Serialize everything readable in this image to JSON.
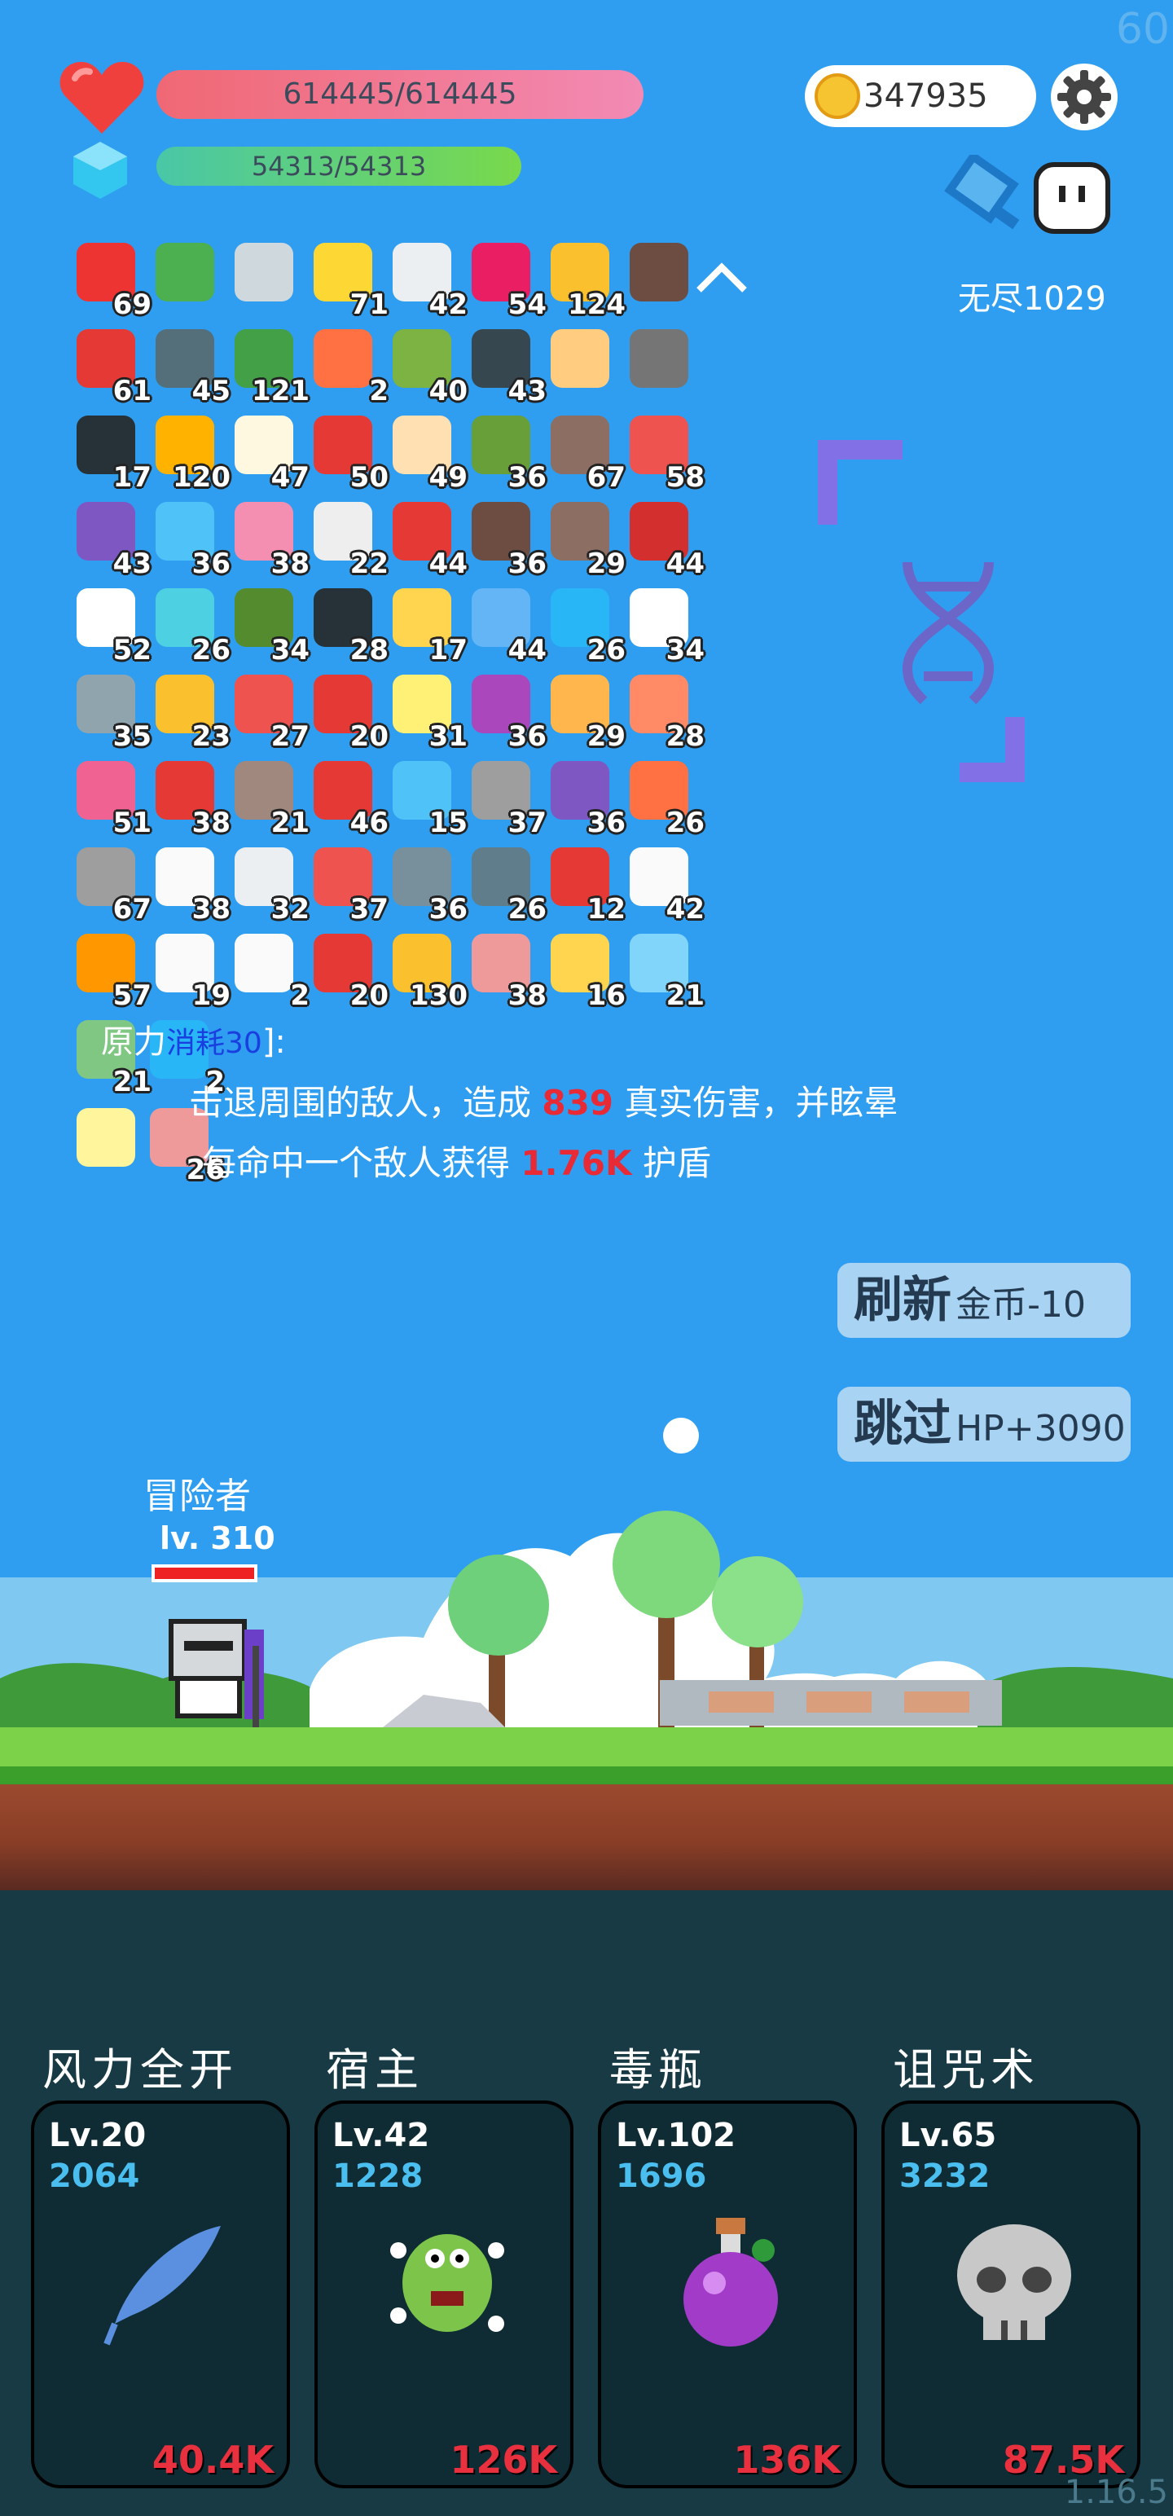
{
  "fps": "60",
  "version": "1.16.5",
  "player": {
    "hp": "614445/614445",
    "mp": "54313/54313"
  },
  "gold": "347935",
  "mode": "无尽1029",
  "items": [
    {
      "n": "sock",
      "c": "69",
      "col": "#e33"
    },
    {
      "n": "book",
      "c": "",
      "col": "#4caf50"
    },
    {
      "n": "sword",
      "c": "",
      "col": "#cfd8dc"
    },
    {
      "n": "star-card",
      "c": "71",
      "col": "#fdd835"
    },
    {
      "n": "letter",
      "c": "42",
      "col": "#eceff1"
    },
    {
      "n": "jam",
      "c": "54",
      "col": "#e91e63"
    },
    {
      "n": "crown",
      "c": "124",
      "col": "#fbc02d"
    },
    {
      "n": "mortar",
      "c": "",
      "col": "#6d4c41"
    },
    {
      "n": "apple",
      "c": "61",
      "col": "#e53935"
    },
    {
      "n": "shield",
      "c": "45",
      "col": "#546e7a"
    },
    {
      "n": "money-heart",
      "c": "121",
      "col": "#43a047"
    },
    {
      "n": "torch",
      "c": "2",
      "col": "#ff7043"
    },
    {
      "n": "cactus",
      "c": "40",
      "col": "#7cb342"
    },
    {
      "n": "bat",
      "c": "43",
      "col": "#37474f"
    },
    {
      "n": "scroll",
      "c": "",
      "col": "#ffcc80"
    },
    {
      "n": "helmet",
      "c": "",
      "col": "#757575"
    },
    {
      "n": "cauldron",
      "c": "17",
      "col": "#263238"
    },
    {
      "n": "bug",
      "c": "120",
      "col": "#ffb300"
    },
    {
      "n": "egg",
      "c": "47",
      "col": "#fff8e1"
    },
    {
      "n": "strawberry",
      "c": "50",
      "col": "#e53935"
    },
    {
      "n": "glove",
      "c": "49",
      "col": "#ffe0b2"
    },
    {
      "n": "turtle",
      "c": "36",
      "col": "#689f38"
    },
    {
      "n": "round-shield",
      "c": "67",
      "col": "#8d6e63"
    },
    {
      "n": "watermelon",
      "c": "58",
      "col": "#ef5350"
    },
    {
      "n": "purple-shield",
      "c": "43",
      "col": "#7e57c2"
    },
    {
      "n": "blue-gem",
      "c": "36",
      "col": "#4fc3f7"
    },
    {
      "n": "ice-cream",
      "c": "38",
      "col": "#f48fb1"
    },
    {
      "n": "bulb",
      "c": "22",
      "col": "#eeeeee"
    },
    {
      "n": "mushroom",
      "c": "44",
      "col": "#e53935"
    },
    {
      "n": "coconut",
      "c": "36",
      "col": "#6d4c41"
    },
    {
      "n": "door",
      "c": "29",
      "col": "#8d6e63"
    },
    {
      "n": "red-shield",
      "c": "44",
      "col": "#d32f2f"
    },
    {
      "n": "flower",
      "c": "52",
      "col": "#ffffff"
    },
    {
      "n": "potion",
      "c": "26",
      "col": "#4dd0e1"
    },
    {
      "n": "grenade",
      "c": "34",
      "col": "#558b2f"
    },
    {
      "n": "hook",
      "c": "28",
      "col": "#263238"
    },
    {
      "n": "magic-wand",
      "c": "17",
      "col": "#ffd54f"
    },
    {
      "n": "pill",
      "c": "44",
      "col": "#64b5f6"
    },
    {
      "n": "chat",
      "c": "26",
      "col": "#29b6f6"
    },
    {
      "n": "ghost",
      "c": "34",
      "col": "#ffffff"
    },
    {
      "n": "disc",
      "c": "35",
      "col": "#90a4ae"
    },
    {
      "n": "sunflower",
      "c": "23",
      "col": "#fbc02d"
    },
    {
      "n": "capsule",
      "c": "27",
      "col": "#ef5350"
    },
    {
      "n": "flask",
      "c": "20",
      "col": "#e53935"
    },
    {
      "n": "note",
      "c": "31",
      "col": "#fff176"
    },
    {
      "n": "crystal-ball",
      "c": "36",
      "col": "#ab47bc"
    },
    {
      "n": "paper-scroll",
      "c": "29",
      "col": "#ffb74d"
    },
    {
      "n": "cake",
      "c": "28",
      "col": "#ff8a65"
    },
    {
      "n": "perfume",
      "c": "51",
      "col": "#f06292"
    },
    {
      "n": "gift",
      "c": "38",
      "col": "#e53935"
    },
    {
      "n": "bow",
      "c": "21",
      "col": "#a1887f"
    },
    {
      "n": "heart",
      "c": "46",
      "col": "#e53935"
    },
    {
      "n": "target",
      "c": "15",
      "col": "#4fc3f7"
    },
    {
      "n": "spike-ball",
      "c": "37",
      "col": "#9e9e9e"
    },
    {
      "n": "box",
      "c": "36",
      "col": "#7e57c2"
    },
    {
      "n": "meteor",
      "c": "26",
      "col": "#ff7043"
    },
    {
      "n": "knife",
      "c": "67",
      "col": "#9e9e9e"
    },
    {
      "n": "cloud",
      "c": "38",
      "col": "#fafafa"
    },
    {
      "n": "clipboard",
      "c": "32",
      "col": "#eceff1"
    },
    {
      "n": "thermometer",
      "c": "37",
      "col": "#ef5350"
    },
    {
      "n": "axe",
      "c": "36",
      "col": "#78909c"
    },
    {
      "n": "compass",
      "c": "26",
      "col": "#607d8b"
    },
    {
      "n": "hearts",
      "c": "12",
      "col": "#e53935"
    },
    {
      "n": "cards",
      "c": "42",
      "col": "#fafafa"
    },
    {
      "n": "journal",
      "c": "57",
      "col": "#ff9800"
    },
    {
      "n": "dice",
      "c": "19",
      "col": "#fafafa"
    },
    {
      "n": "speech",
      "c": "2",
      "col": "#fafafa"
    },
    {
      "n": "red-card",
      "c": "20",
      "col": "#e53935"
    },
    {
      "n": "coins",
      "c": "130",
      "col": "#fbc02d"
    },
    {
      "n": "meat",
      "c": "38",
      "col": "#ef9a9a"
    },
    {
      "n": "ring",
      "c": "16",
      "col": "#ffd54f"
    },
    {
      "n": "halo",
      "c": "21",
      "col": "#81d4fa"
    }
  ],
  "extra_items": [
    {
      "n": "green-spirit",
      "c": "21",
      "col": "#81c784"
    },
    {
      "n": "blue-hex-gem",
      "c": "2",
      "col": "#29b6f6"
    },
    {
      "n": "lightbulb-frame",
      "c": "",
      "col": "#fff59d"
    },
    {
      "n": "staff-frame",
      "c": "26",
      "col": "#ef9a9a"
    }
  ],
  "description": {
    "cost_prefix": "原力",
    "cost": "消耗30",
    "cost_suffix": "]:",
    "line1_pre": "击退周围的敌人，造成 ",
    "line1_val": "839",
    "line1_post": " 真实伤害，并眩晕",
    "line2_pre": "每命中一个敌人获得 ",
    "line2_val": "1.76K",
    "line2_post": " 护盾"
  },
  "buttons": {
    "refresh": {
      "main": "刷新",
      "sub": "金币-10"
    },
    "skip": {
      "main": "跳过",
      "sub": "HP+3090"
    }
  },
  "hero": {
    "name": "冒险者",
    "level": "lv. 310"
  },
  "skills": [
    {
      "name": "风力全开",
      "lv": "Lv.20",
      "power": "2064",
      "dmg": "40.4K",
      "icon": "feather-icon",
      "color": "#5b8fe0"
    },
    {
      "name": "宿主",
      "lv": "Lv.42",
      "power": "1228",
      "dmg": "126K",
      "icon": "germ-icon",
      "color": "#7cc44a"
    },
    {
      "name": "毒瓶",
      "lv": "Lv.102",
      "power": "1696",
      "dmg": "136K",
      "icon": "poison-bottle-icon",
      "color": "#a23cc8"
    },
    {
      "name": "诅咒术",
      "lv": "Lv.65",
      "power": "3232",
      "dmg": "87.5K",
      "icon": "skull-icon",
      "color": "#c8c8c8"
    }
  ]
}
